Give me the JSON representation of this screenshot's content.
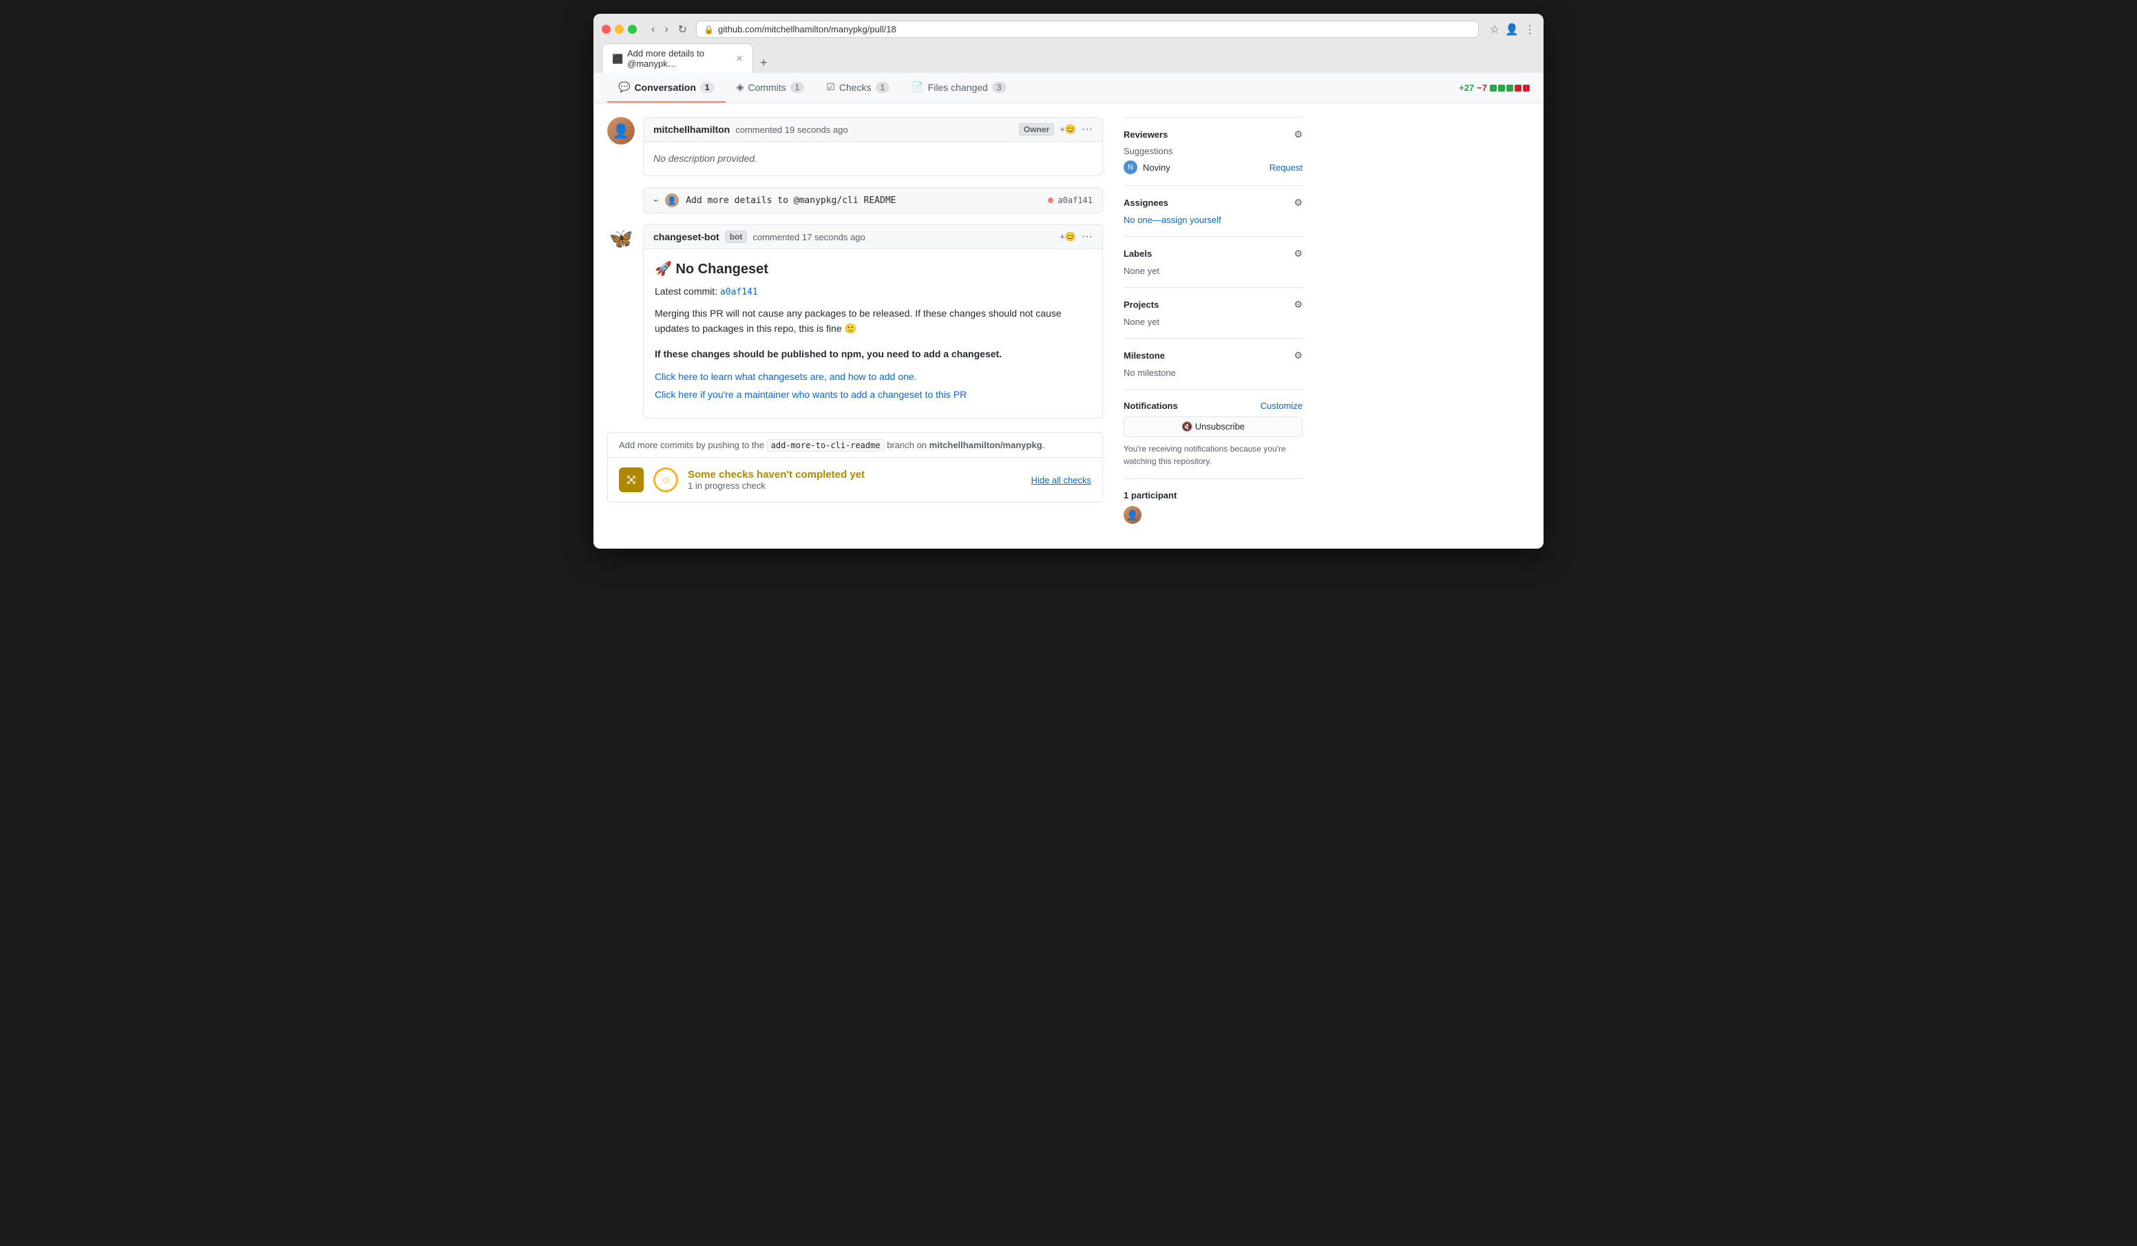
{
  "browser": {
    "url": "github.com/mitchellhamilton/manypkg/pull/18",
    "tab_title": "Add more details to @manypk…",
    "tab_favicon": "⬤"
  },
  "pr_tabs": [
    {
      "id": "conversation",
      "label": "Conversation",
      "badge": "1",
      "icon": "💬",
      "active": true
    },
    {
      "id": "commits",
      "label": "Commits",
      "badge": "1",
      "icon": "◈",
      "active": false
    },
    {
      "id": "checks",
      "label": "Checks",
      "badge": "1",
      "icon": "☑",
      "active": false
    },
    {
      "id": "files_changed",
      "label": "Files changed",
      "badge": "3",
      "icon": "📄",
      "active": false
    }
  ],
  "diff_stats": {
    "additions": "+27",
    "deletions": "−7"
  },
  "first_comment": {
    "author": "mitchellhamilton",
    "time": "commented 19 seconds ago",
    "badge": "Owner",
    "body": "No description provided.",
    "emoji_btn": "+😊",
    "more_btn": "···"
  },
  "commit_ref": {
    "message": "Add more details to @manypkg/cli README",
    "sha": "a0af141"
  },
  "bot_comment": {
    "author": "changeset-bot",
    "bot_badge": "bot",
    "time": "commented 17 seconds ago",
    "emoji_btn": "+😊",
    "more_btn": "···",
    "title": "🚀 No Changeset",
    "latest_commit_label": "Latest commit:",
    "latest_commit_sha": "a0af141",
    "para1": "Merging this PR will not cause any packages to be released. If these changes should not cause updates to packages in this repo, this is fine 🙂",
    "para2_bold": "If these changes should be published to npm, you need to add a changeset.",
    "link1": "Click here to learn what changesets are, and how to add one.",
    "link2": "Click here if you're a maintainer who wants to add a changeset to this PR"
  },
  "push_text": {
    "prefix": "Add more commits by pushing to the",
    "branch": "add-more-to-cli-readme",
    "suffix": "branch on",
    "repo": "mitchellhamilton/manypkg"
  },
  "checks_status": {
    "title": "Some checks haven't completed yet",
    "subtitle": "1 in progress check",
    "hide_link": "Hide all checks"
  },
  "sidebar": {
    "reviewers": {
      "title": "Reviewers",
      "suggestions_label": "Suggestions",
      "reviewer_name": "Noviny",
      "request_label": "Request"
    },
    "assignees": {
      "title": "Assignees",
      "none_text": "No one—assign yourself"
    },
    "labels": {
      "title": "Labels",
      "none_text": "None yet"
    },
    "projects": {
      "title": "Projects",
      "none_text": "None yet"
    },
    "milestone": {
      "title": "Milestone",
      "none_text": "No milestone"
    },
    "notifications": {
      "title": "Notifications",
      "customize_label": "Customize",
      "unsubscribe_label": "🔇 Unsubscribe",
      "watching_text": "You're receiving notifications because you're watching this repository."
    },
    "participants": {
      "count_label": "1 participant"
    }
  }
}
